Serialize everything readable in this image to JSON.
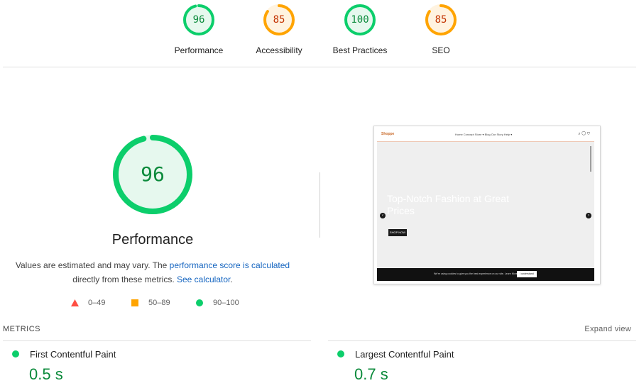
{
  "colors": {
    "pass": "#0cce6b",
    "pass_text": "#0b8a3b",
    "average": "#ffa400",
    "average_text": "#c33300",
    "fail": "#ff4e42",
    "link": "#1565c0"
  },
  "categories": [
    {
      "label": "Performance",
      "score": "96",
      "rating": "pass"
    },
    {
      "label": "Accessibility",
      "score": "85",
      "rating": "average"
    },
    {
      "label": "Best Practices",
      "score": "100",
      "rating": "pass"
    },
    {
      "label": "SEO",
      "score": "85",
      "rating": "average"
    }
  ],
  "performance": {
    "score": "96",
    "title": "Performance",
    "desc_prefix": "Values are estimated and may vary. The ",
    "desc_link1": "performance score is calculated",
    "desc_middle": " directly from these metrics. ",
    "desc_link2": "See calculator",
    "desc_suffix": "."
  },
  "legend": [
    {
      "icon": "triangle-fail-icon",
      "range": "0–49"
    },
    {
      "icon": "square-average-icon",
      "range": "50–89"
    },
    {
      "icon": "circle-pass-icon",
      "range": "90–100"
    }
  ],
  "screenshot": {
    "logo": "Shoppe",
    "menu": "Home   Concept Store ▾   Blog   Our Story   Help ▾",
    "hero_title": "Top-Notch Fashion at Great Prices",
    "shop_button": "SHOP NOW",
    "cookie_text": "We're using cookies to give you the best experience on our site.  Learn More",
    "cookie_button": "I understand"
  },
  "metrics": {
    "title": "METRICS",
    "expand": "Expand view",
    "items": [
      {
        "name": "First Contentful Paint",
        "value": "0.5 s"
      },
      {
        "name": "Largest Contentful Paint",
        "value": "0.7 s"
      }
    ]
  }
}
